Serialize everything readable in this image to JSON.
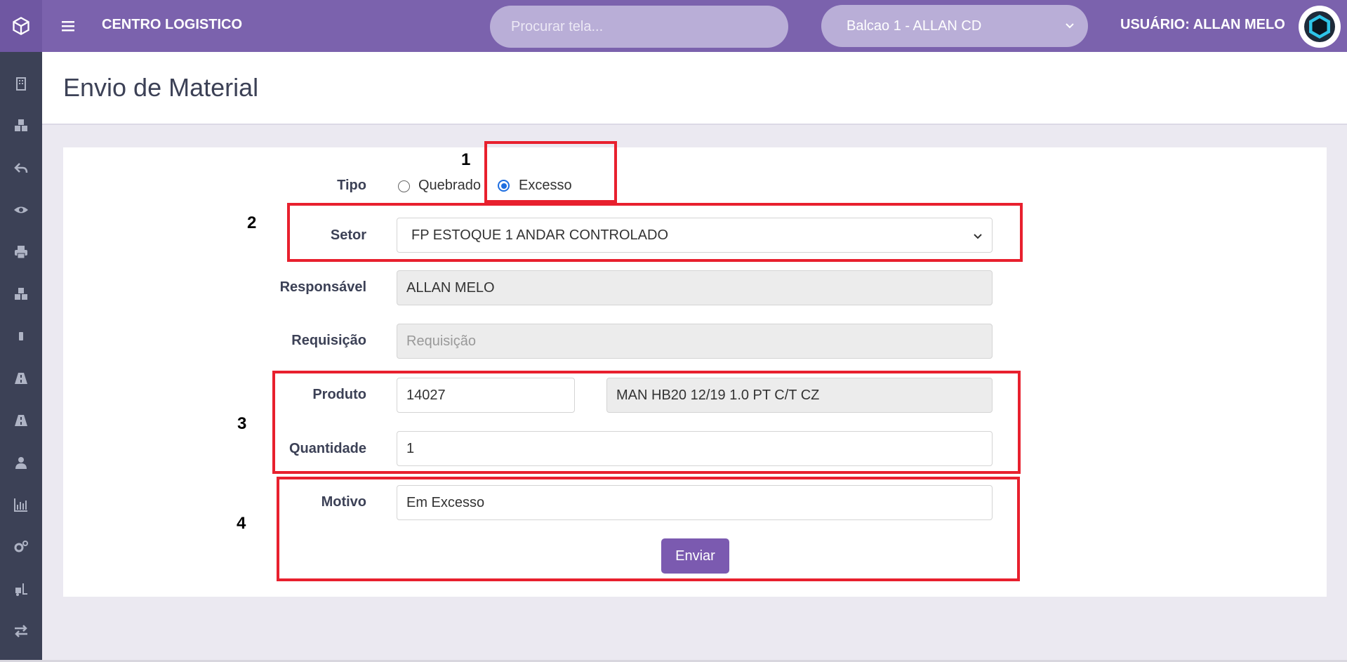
{
  "header": {
    "app_title": "CENTRO LOGISTICO",
    "search_placeholder": "Procurar tela...",
    "balcao_selected": "Balcao 1 - ALLAN CD",
    "user_label": "USUÁRIO: ALLAN MELO"
  },
  "sidebar": {
    "icons": [
      "building-icon",
      "cubes-icon",
      "reply-icon",
      "eye-icon",
      "print-icon",
      "cubes-icon",
      "mobile-icon",
      "road-icon",
      "road-icon",
      "user-icon",
      "bar-chart-icon",
      "gears-icon",
      "forklift-icon",
      "exchange-icon"
    ]
  },
  "page": {
    "title": "Envio de Material"
  },
  "form": {
    "tipo_label": "Tipo",
    "tipo_options": [
      "Quebrado",
      "Excesso"
    ],
    "tipo_selected": "Excesso",
    "setor_label": "Setor",
    "setor_value": "FP ESTOQUE 1 ANDAR CONTROLADO",
    "responsavel_label": "Responsável",
    "responsavel_value": "ALLAN MELO",
    "requisicao_label": "Requisição",
    "requisicao_placeholder": "Requisição",
    "produto_label": "Produto",
    "produto_code": "14027",
    "produto_desc": "MAN HB20 12/19 1.0 PT C/T CZ",
    "quantidade_label": "Quantidade",
    "quantidade_value": "1",
    "motivo_label": "Motivo",
    "motivo_value": "Em Excesso",
    "submit_label": "Enviar"
  },
  "annotations": [
    "1",
    "2",
    "3",
    "4"
  ],
  "colors": {
    "topbar": "#7b62ad",
    "sidebar": "#3c4156",
    "button": "#7b5ab0",
    "annotation_box": "#e8202e"
  }
}
